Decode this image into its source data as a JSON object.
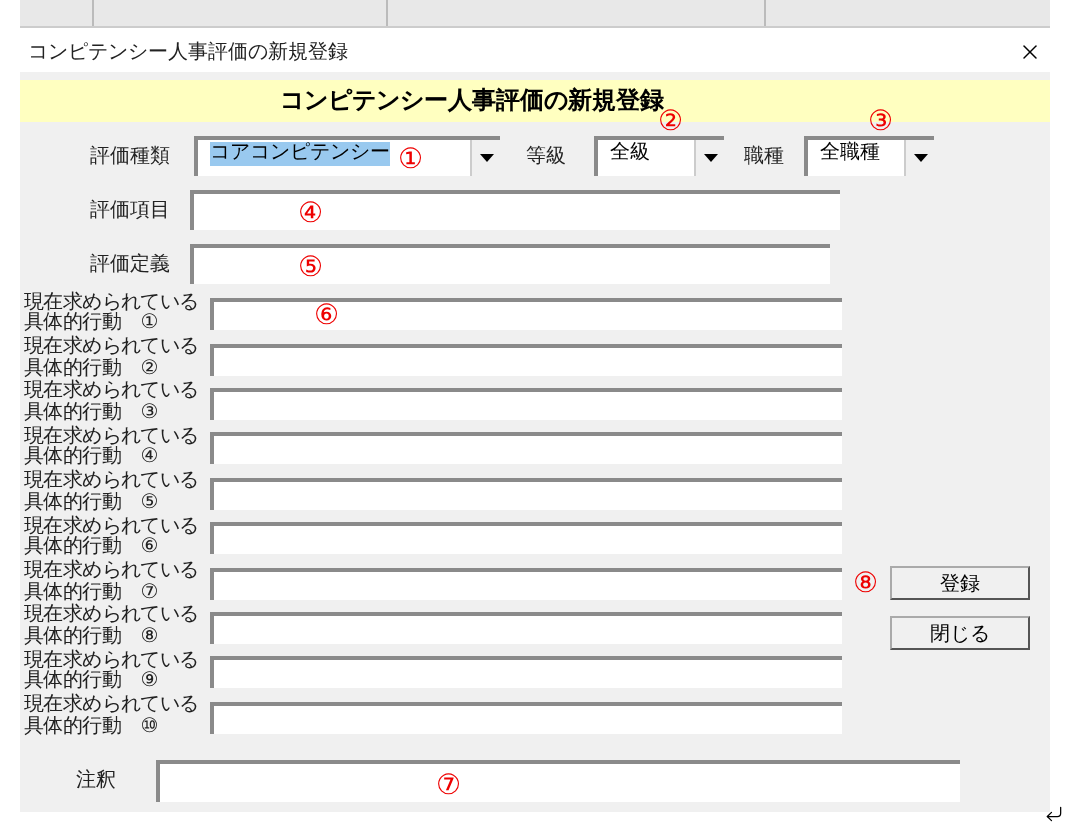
{
  "window": {
    "title": "コンピテンシー人事評価の新規登録"
  },
  "banner": "コンピテンシー人事評価の新規登録",
  "selectors": [
    {
      "label": "評価種類",
      "value": "コアコンピテンシー",
      "highlighted": true,
      "annotation": "①"
    },
    {
      "label": "等級",
      "value": "全級",
      "highlighted": false,
      "annotation": "②"
    },
    {
      "label": "職種",
      "value": "全職種",
      "highlighted": false,
      "annotation": "③"
    }
  ],
  "text_fields": [
    {
      "label": "評価項目",
      "annotation": "④"
    },
    {
      "label": "評価定義",
      "annotation": "⑤"
    }
  ],
  "behaviors": [
    {
      "label": "現在求められている具体的行動　①",
      "annotation": "⑥"
    },
    {
      "label": "現在求められている具体的行動　②"
    },
    {
      "label": "現在求められている具体的行動　③"
    },
    {
      "label": "現在求められている具体的行動　④"
    },
    {
      "label": "現在求められている具体的行動　⑤"
    },
    {
      "label": "現在求められている具体的行動　⑥"
    },
    {
      "label": "現在求められている具体的行動　⑦"
    },
    {
      "label": "現在求められている具体的行動　⑧"
    },
    {
      "label": "現在求められている具体的行動　⑨"
    },
    {
      "label": "現在求められている具体的行動　⑩"
    }
  ],
  "buttons": [
    {
      "label": "登録",
      "annotation": "⑧"
    },
    {
      "label": "閉じる"
    }
  ],
  "note": {
    "label": "注釈",
    "annotation": "⑦"
  }
}
